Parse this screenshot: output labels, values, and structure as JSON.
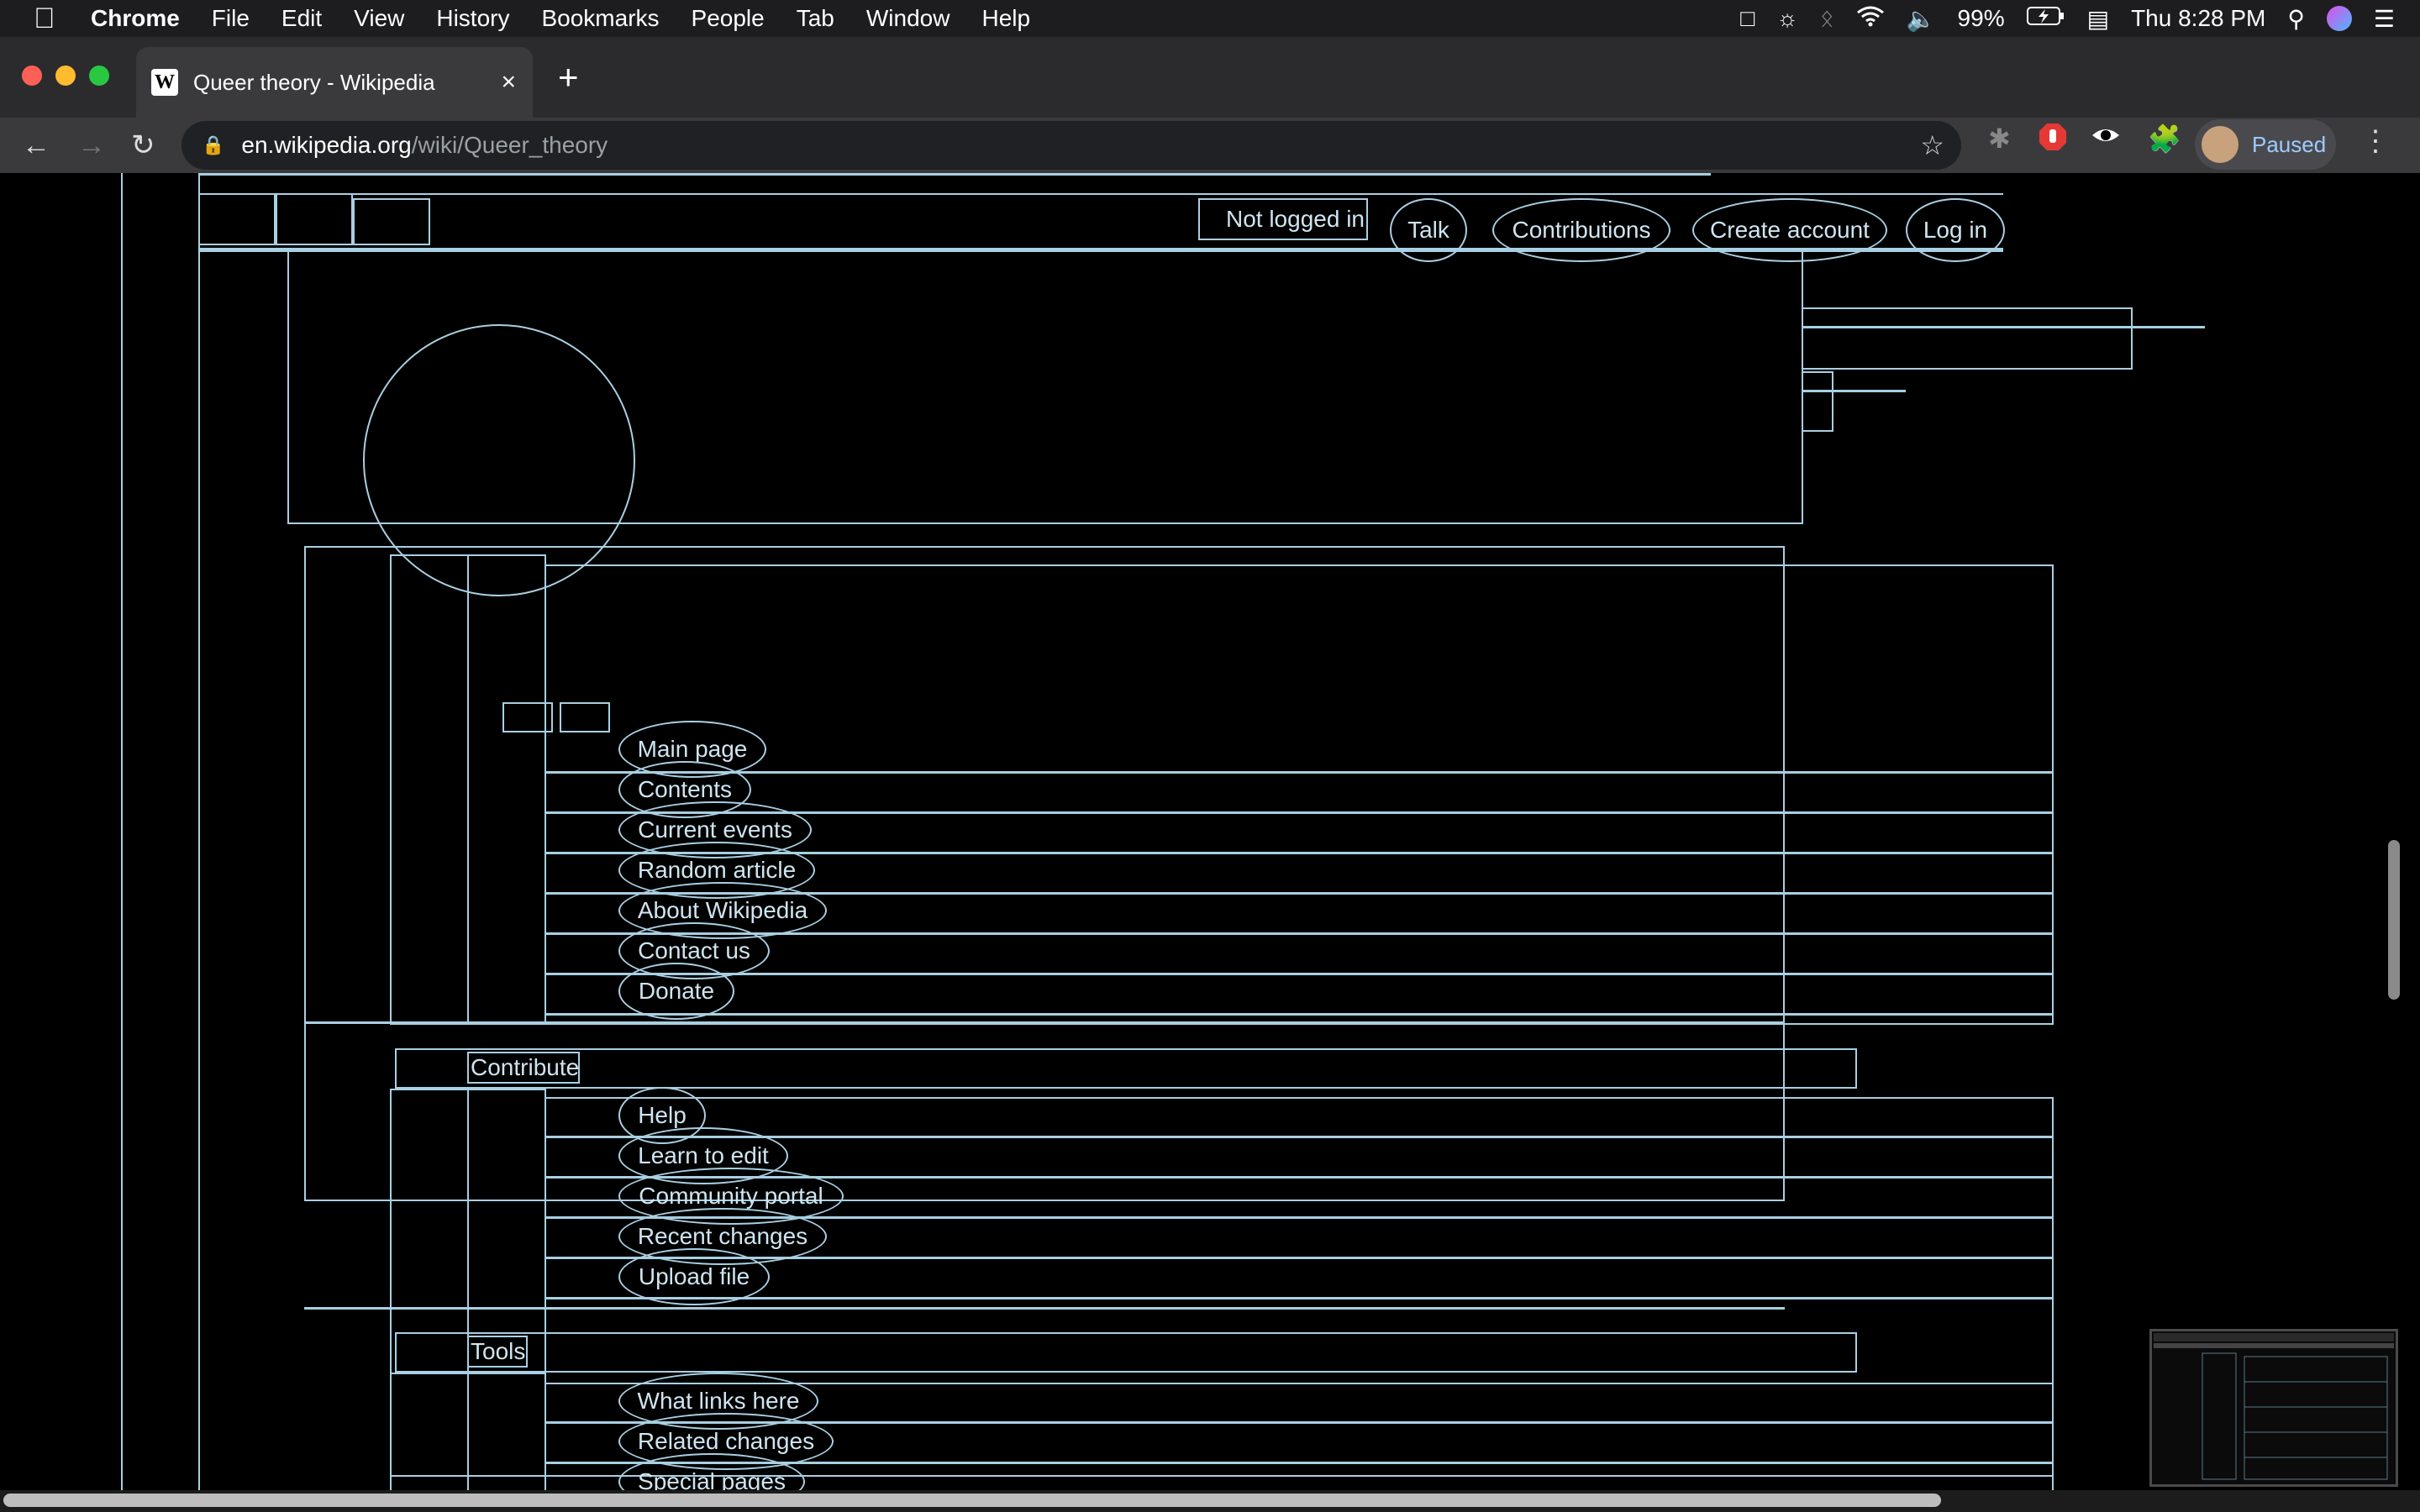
{
  "menubar": {
    "app": "Chrome",
    "menus": [
      "File",
      "Edit",
      "View",
      "History",
      "Bookmarks",
      "People",
      "Tab",
      "Window",
      "Help"
    ],
    "battery": "99%",
    "clock": "Thu 8:28 PM"
  },
  "colors": {
    "outline": "#a9cfe2",
    "close": "#fe5f57",
    "minimize": "#febc2e",
    "zoom": "#28c840"
  },
  "tab": {
    "favicon": "W",
    "title": "Queer theory - Wikipedia",
    "close": "×"
  },
  "toolbar": {
    "new_tab": "+",
    "back": "←",
    "forward": "→",
    "reload": "↻",
    "url_host": "en.wikipedia.org",
    "url_path": "/wiki/Queer_theory",
    "profile_label": "Paused"
  },
  "page": {
    "user_links": {
      "not_logged_in": "Not logged in",
      "talk": "Talk",
      "contributions": "Contributions",
      "create_account": "Create account",
      "log_in": "Log in"
    },
    "navigation": [
      "Main page",
      "Contents",
      "Current events",
      "Random article",
      "About Wikipedia",
      "Contact us",
      "Donate"
    ],
    "contribute_heading": "Contribute",
    "contribute": [
      "Help",
      "Learn to edit",
      "Community portal",
      "Recent changes",
      "Upload file"
    ],
    "tools_heading": "Tools",
    "tools": [
      "What links here",
      "Related changes",
      "Special pages"
    ]
  }
}
